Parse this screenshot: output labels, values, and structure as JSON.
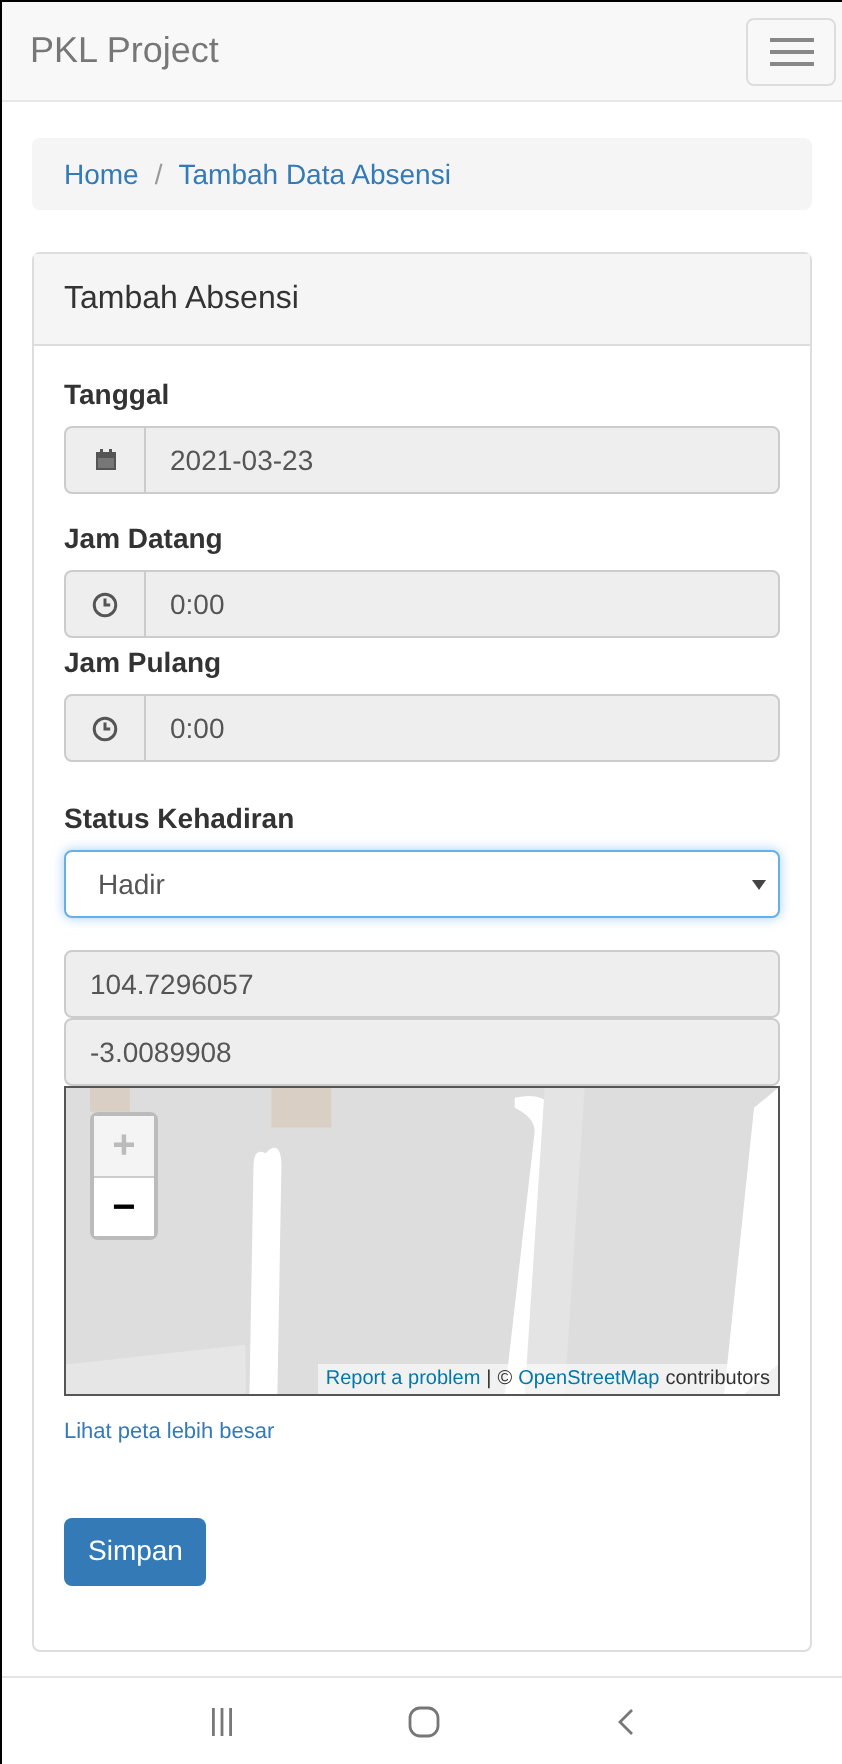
{
  "navbar": {
    "brand": "PKL Project"
  },
  "breadcrumb": {
    "separator": "/",
    "items": [
      "Home",
      "Tambah Data Absensi"
    ]
  },
  "card": {
    "title": "Tambah Absensi",
    "fields": [
      {
        "label": "Tanggal",
        "kind": "date",
        "value": "2021-03-23"
      },
      {
        "label": "Jam Datang",
        "kind": "time",
        "value": "0:00"
      },
      {
        "label": "Jam Pulang",
        "kind": "time",
        "value": "0:00"
      }
    ],
    "status": {
      "label": "Status Kehadiran",
      "value": "Hadir"
    },
    "longitude": "104.7296057",
    "latitude": "-3.0089908",
    "map": {
      "zoom_controls": [
        {
          "label": "+",
          "disabled": true
        },
        {
          "label": "−",
          "disabled": false
        }
      ],
      "attribution": [
        {
          "text": "Report a problem",
          "link": true
        },
        {
          "text": "|",
          "link": false
        },
        {
          "text": "©",
          "link": false
        },
        {
          "text": "OpenStreetMap",
          "link": true
        },
        {
          "text": "contributors",
          "link": false
        }
      ]
    },
    "map_link": "Lihat peta lebih besar",
    "submit": "Simpan"
  }
}
